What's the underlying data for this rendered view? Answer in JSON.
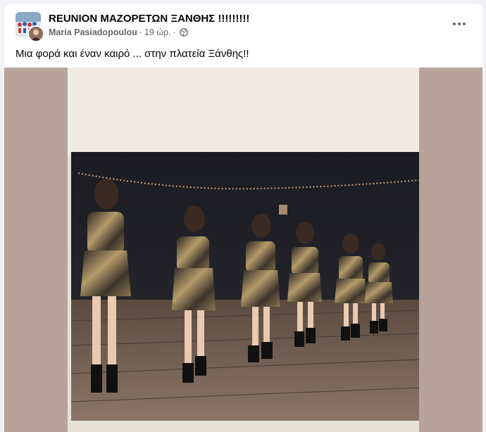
{
  "post": {
    "group_name": "REUNION ΜΑΖΟΡΕΤΩΝ ΞΑΝΘΗΣ !!!!!!!!!",
    "author": "Maria Pasiadopoulou",
    "time": "19 ώρ.",
    "dot": "·",
    "privacy_icon": "globe-icon",
    "more_icon": "more-options-icon",
    "message": "Μια φορά και έναν καιρό ... στην πλατεία Ξάνθης!!"
  },
  "colors": {
    "media_background": "#b8a39b",
    "photo_backdrop": "#e7e1d6",
    "text_primary": "#050505",
    "text_secondary": "#65676b"
  }
}
